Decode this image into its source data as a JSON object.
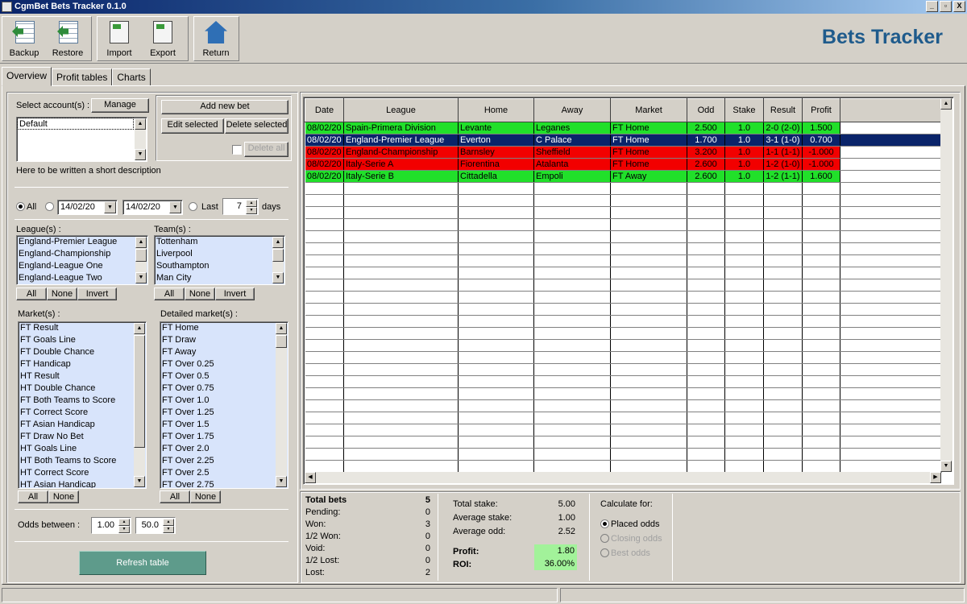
{
  "window": {
    "title": "CgmBet Bets Tracker  0.1.0",
    "controls": [
      "_",
      "▫",
      "X"
    ]
  },
  "toolbar": {
    "buttons": [
      {
        "label": "Backup",
        "icon": "backup-sheet-icon"
      },
      {
        "label": "Restore",
        "icon": "restore-sheet-icon"
      },
      {
        "label": "Import",
        "icon": "import-file-icon"
      },
      {
        "label": "Export",
        "icon": "export-file-icon"
      },
      {
        "label": "Return",
        "icon": "home-icon"
      }
    ],
    "brand": "Bets Tracker"
  },
  "tabs": [
    "Overview",
    "Profit tables",
    "Charts"
  ],
  "accounts": {
    "label": "Select account(s) :",
    "manage": "Manage",
    "items": [
      "Default"
    ],
    "description": "Here to be written a short description"
  },
  "bet_actions": {
    "add": "Add new bet",
    "edit": "Edit selected",
    "delete": "Delete selected",
    "delete_all": "Delete all"
  },
  "date_filter": {
    "all": "All",
    "from": "14/02/20",
    "to": "14/02/20",
    "last": "Last",
    "last_value": "7",
    "days": "days"
  },
  "leagues": {
    "label": "League(s) :",
    "items": [
      "England-Premier League",
      "England-Championship",
      "England-League One",
      "England-League Two"
    ]
  },
  "teams": {
    "label": "Team(s) :",
    "items": [
      "Tottenham",
      "Liverpool",
      "Southampton",
      "Man City"
    ]
  },
  "markets": {
    "label": "Market(s) :",
    "items": [
      "FT Result",
      "FT Goals Line",
      "FT Double Chance",
      "FT Handicap",
      "HT Result",
      "HT Double Chance",
      "FT Both Teams to Score",
      "FT Correct Score",
      "FT Asian Handicap",
      "FT Draw No Bet",
      "HT Goals Line",
      "HT Both Teams to Score",
      "HT Correct Score",
      "HT Asian Handicap"
    ]
  },
  "detailed_markets": {
    "label": "Detailed market(s) :",
    "items": [
      "FT Home",
      "FT Draw",
      "FT Away",
      "FT Over 0.25",
      "FT Over 0.5",
      "FT Over 0.75",
      "FT Over 1.0",
      "FT Over 1.25",
      "FT Over 1.5",
      "FT Over 1.75",
      "FT Over 2.0",
      "FT Over 2.25",
      "FT Over 2.5",
      "FT Over 2.75"
    ]
  },
  "selectors": {
    "all": "All",
    "none": "None",
    "invert": "Invert"
  },
  "odds": {
    "label": "Odds between :",
    "min": "1.00",
    "max": "50.0"
  },
  "refresh": "Refresh table",
  "table": {
    "headers": [
      "Date",
      "League",
      "Home",
      "Away",
      "Market",
      "Odd",
      "Stake",
      "Result",
      "Profit"
    ],
    "rows": [
      {
        "status": "green",
        "cells": [
          "08/02/20",
          "Spain-Primera Division",
          "Levante",
          "Leganes",
          "FT Home",
          "2.500",
          "1.0",
          "2-0 (2-0)",
          "1.500"
        ]
      },
      {
        "status": "sel",
        "cells": [
          "08/02/20",
          "England-Premier League",
          "Everton",
          "C Palace",
          "FT Home",
          "1.700",
          "1.0",
          "3-1 (1-0)",
          "0.700"
        ]
      },
      {
        "status": "red",
        "cells": [
          "08/02/20",
          "England-Championship",
          "Barnsley",
          "Sheffield",
          "FT Home",
          "3.200",
          "1.0",
          "1-1 (1-1)",
          "-1.000"
        ]
      },
      {
        "status": "red",
        "cells": [
          "08/02/20",
          "Italy-Serie A",
          "Fiorentina",
          "Atalanta",
          "FT Home",
          "2.600",
          "1.0",
          "1-2 (1-0)",
          "-1.000"
        ]
      },
      {
        "status": "green",
        "cells": [
          "08/02/20",
          "Italy-Serie B",
          "Cittadella",
          "Empoli",
          "FT Away",
          "2.600",
          "1.0",
          "1-2 (1-1)",
          "1.600"
        ]
      }
    ]
  },
  "summary": {
    "counts": [
      {
        "label": "Total bets",
        "value": "5"
      },
      {
        "label": "Pending:",
        "value": "0"
      },
      {
        "label": "Won:",
        "value": "3"
      },
      {
        "label": "1/2 Won:",
        "value": "0"
      },
      {
        "label": "Void:",
        "value": "0"
      },
      {
        "label": "1/2 Lost:",
        "value": "0"
      },
      {
        "label": "Lost:",
        "value": "2"
      }
    ],
    "total_stake_label": "Total stake:",
    "total_stake": "5.00",
    "avg_stake_label": "Average stake:",
    "avg_stake": "1.00",
    "avg_odd_label": "Average odd:",
    "avg_odd": "2.52",
    "profit_label": "Profit:",
    "profit": "1.80",
    "roi_label": "ROI:",
    "roi": "36.00%",
    "calc_label": "Calculate for:",
    "calc_options": [
      "Placed odds",
      "Closing odds",
      "Best odds"
    ]
  },
  "colors": {
    "win": "#21e02a",
    "loss": "#f20000",
    "selected": "#0a246a",
    "brand": "#1f5b8c",
    "refresh": "#5e9b8b"
  }
}
